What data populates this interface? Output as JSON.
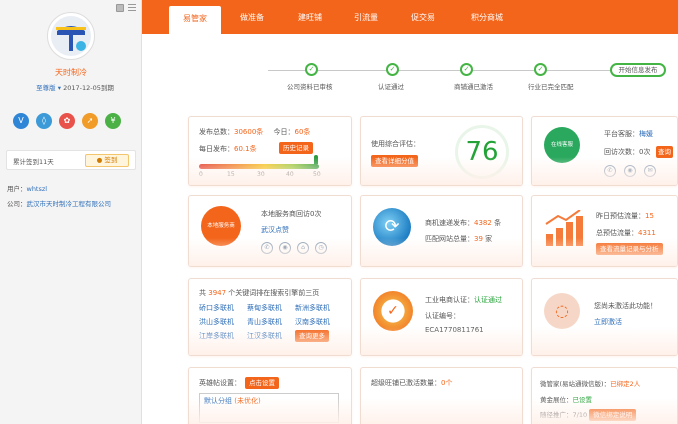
{
  "sidebar": {
    "name": "天时制冷",
    "edition": "至尊版",
    "expiry": "2017-12-05到期",
    "checkin": "累计签到11天",
    "checkin_btn": "签到",
    "user_label": "用户：",
    "user_value": "whtszl",
    "company_label": "公司：",
    "company_value": "武汉市天时制冷工程有限公司"
  },
  "tabs": [
    {
      "label": "易管家"
    },
    {
      "label": "做准备"
    },
    {
      "label": "建旺铺"
    },
    {
      "label": "引流量"
    },
    {
      "label": "促交易"
    },
    {
      "label": "积分商城"
    }
  ],
  "progress": {
    "steps": [
      "公司资料已审核",
      "认证通过",
      "商铺通已激活",
      "行业已完全匹配"
    ],
    "start_btn": "开始信息发布"
  },
  "stats": {
    "total_label": "发布总数：",
    "total_value": "30600条",
    "today_label": "今日：",
    "today_value": "60条",
    "daily_label": "每日发布：",
    "daily_value": "60.1条",
    "history_btn": "历史记录",
    "scale": [
      "0",
      "15",
      "30",
      "40",
      "50"
    ]
  },
  "score": {
    "label": "使用综合评估：",
    "btn": "查看详细分值",
    "value": "76"
  },
  "service": {
    "label": "平台客服：",
    "name": "梅媛",
    "visits_label": "回访次数：",
    "visits_value": "0次",
    "btn": "查询",
    "avatar_text": "在线客服"
  },
  "local": {
    "title": "本地服务商回访0次",
    "link": "武汉点赞",
    "icon_label": "本地服务商"
  },
  "traffic": {
    "line1_label": "商机速递发布：",
    "line1_value": "4382",
    "line1_unit": "条",
    "line2_label": "匹配网站总量：",
    "line2_value": "39",
    "line2_unit": "家"
  },
  "flow": {
    "yesterday_label": "昨日预估流量：",
    "yesterday_value": "15",
    "total_label": "总预估流量：",
    "total_value": "4311",
    "btn": "查看流量记录与分析"
  },
  "keywords": {
    "prefix": "共",
    "count": "3947",
    "suffix": "个关键词排在搜索引擎前三页",
    "items": [
      "硚口多联机",
      "蔡甸多联机",
      "新洲多联机",
      "洪山多联机",
      "青山多联机",
      "汉南多联机",
      "江岸多联机",
      "江汉多联机"
    ],
    "btn": "查询更多"
  },
  "ecom": {
    "label": "工业电商认证：",
    "status": "认证通过",
    "code_label": "认证编号：",
    "code_value": "ECA1770811761"
  },
  "wechat": {
    "text": "您尚未激活此功能！",
    "link": "立即激活"
  },
  "bottom": {
    "title": "英雄帖设置：",
    "set_btn": "点击设置",
    "placeholder": "默认分组",
    "opt_tag": "(未优化)",
    "tree_label": "超级旺铺已激活数量：",
    "tree_value": "0个",
    "wx_label": "微管家(易站通微信版)：",
    "wx_value": "已绑定2人",
    "gold_label": "黄金展位：",
    "gold_value": "已设置",
    "promo_label": "随径推广：",
    "promo_value": "7/10",
    "promo_btn": "微信绑定说明"
  }
}
